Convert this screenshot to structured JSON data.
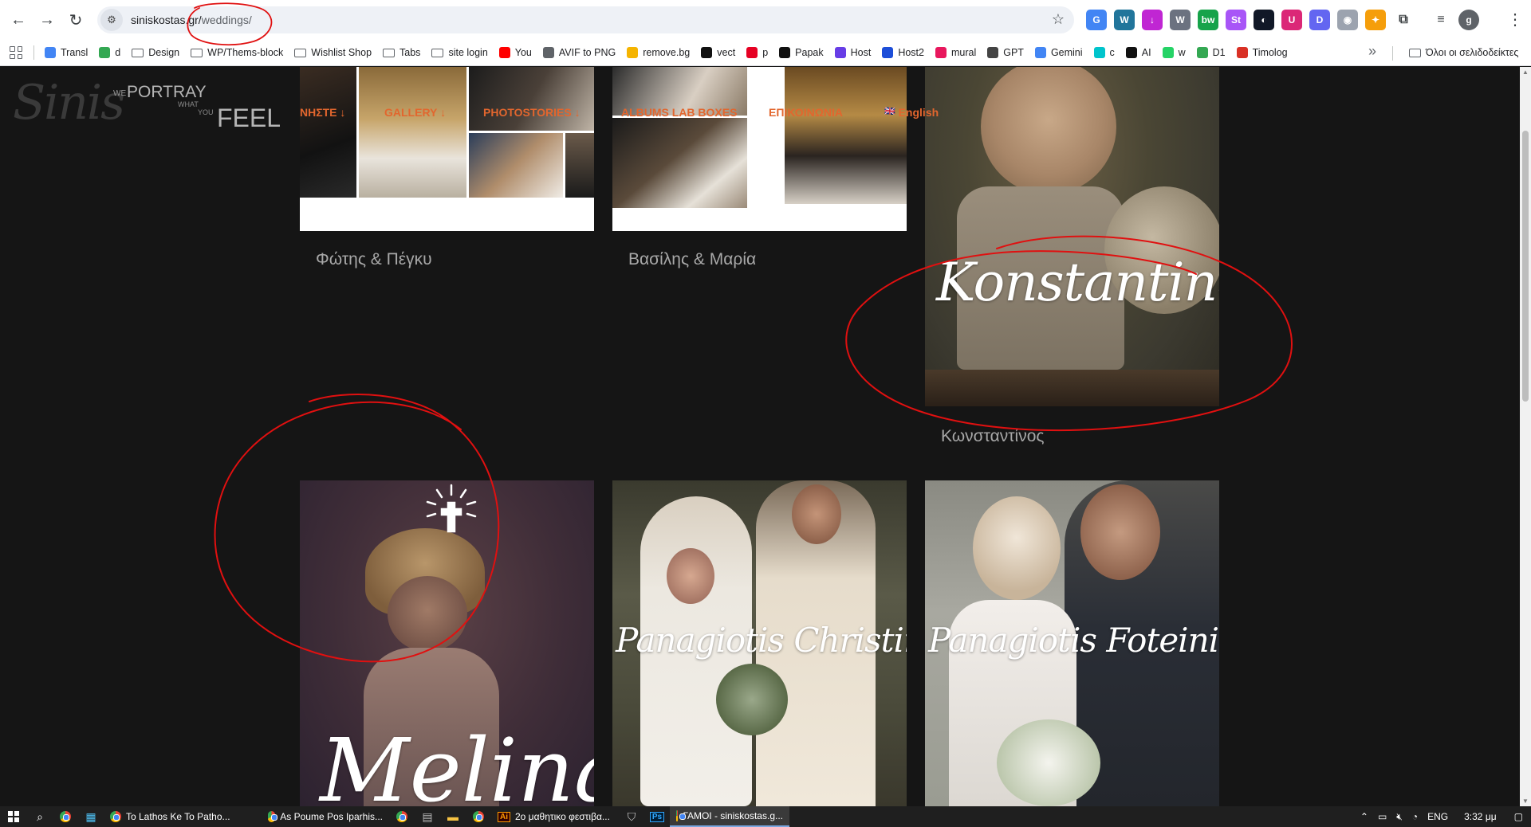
{
  "browser": {
    "url_host": "siniskostas.gr/",
    "url_path": "weddings/",
    "bookmarks": [
      {
        "label": "Transl",
        "icon": "translate-icon",
        "color": "#4285f4"
      },
      {
        "label": "d",
        "icon": "drive-icon",
        "color": "#34a853"
      },
      {
        "label": "Design",
        "icon": "folder-icon"
      },
      {
        "label": "WP/Thems-block",
        "icon": "folder-icon"
      },
      {
        "label": "Wishlist Shop",
        "icon": "folder-icon"
      },
      {
        "label": "Tabs",
        "icon": "folder-icon"
      },
      {
        "label": "site login",
        "icon": "folder-icon"
      },
      {
        "label": "You",
        "icon": "youtube-icon",
        "color": "#ff0000"
      },
      {
        "label": "AVIF to PNG",
        "icon": "cloud-icon",
        "color": "#5f6368"
      },
      {
        "label": "remove.bg",
        "icon": "removebg-icon",
        "color": "#f5b400"
      },
      {
        "label": "vect",
        "icon": "vectorizer-icon",
        "color": "#111111"
      },
      {
        "label": "p",
        "icon": "pinterest-icon",
        "color": "#e60023"
      },
      {
        "label": "Papak",
        "icon": "papak-icon",
        "color": "#111111"
      },
      {
        "label": "Host",
        "icon": "host-icon",
        "color": "#673de6"
      },
      {
        "label": "Host2",
        "icon": "host2-icon",
        "color": "#1d4ed8"
      },
      {
        "label": "mural",
        "icon": "mural-icon",
        "color": "#e8175d"
      },
      {
        "label": "GPT",
        "icon": "chatgpt-icon",
        "color": "#444444"
      },
      {
        "label": "Gemini",
        "icon": "gemini-icon",
        "color": "#4285f4"
      },
      {
        "label": "c",
        "icon": "canva-icon",
        "color": "#00c4cc"
      },
      {
        "label": "AI",
        "icon": "ai-icon",
        "color": "#111111"
      },
      {
        "label": "w",
        "icon": "whatsapp-icon",
        "color": "#25d366"
      },
      {
        "label": "D1",
        "icon": "drive-icon",
        "color": "#34a853"
      },
      {
        "label": "Timolog",
        "icon": "timolog-icon",
        "color": "#d93025"
      }
    ],
    "all_bookmarks_label": "Όλοι οι σελιδοδείκτες"
  },
  "site": {
    "logo_script": "Sinis",
    "logo_we": "WE",
    "logo_portray": "PORTRAY",
    "logo_what": "WHAT",
    "logo_you": "YOU",
    "logo_feel": "FEEL",
    "nav": [
      "ΝΗΣΤΕ",
      "GALLERY",
      "PHOTOSTORIES",
      "ALBUMS LAB BOXES",
      "ΕΠΙΚΟΙΝΩΝΙΑ",
      "English"
    ],
    "nav_arrow": "↓",
    "nav_flag": "🇬🇧",
    "nav_color": "#e2662e",
    "cards_row1": [
      {
        "caption": "Φώτης & Πέγκυ"
      },
      {
        "caption": "Βασίλης & Μαρία"
      },
      {
        "caption": "Κωνσταντίνος",
        "script": "Konstantinos"
      }
    ],
    "cards_row2": [
      {
        "script": "Melina",
        "cross": "✝"
      },
      {
        "script": "Panagiotis Christina"
      },
      {
        "script": "Panagiotis Foteini"
      }
    ],
    "annotation_color": "#e01010"
  },
  "taskbar": {
    "tasks": [
      {
        "label": "To Lathos Ke To Patho..."
      },
      {
        "label": "As Poume Pos Iparhis..."
      },
      {
        "label": "2ο μαθητικο φεστιβα..."
      },
      {
        "label": "ΓΑΜΟΙ - siniskostas.g..."
      }
    ],
    "lang": "ENG",
    "time": "3:32 μμ"
  }
}
